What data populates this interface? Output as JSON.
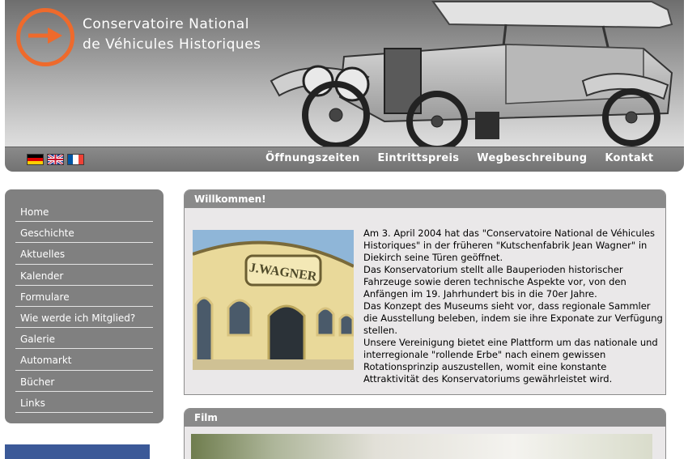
{
  "site": {
    "title_line1": "Conservatoire National",
    "title_line2": "de Véhicules Historiques",
    "accent_color": "#ee6a2c"
  },
  "languages": [
    {
      "name": "Deutsch",
      "icon": "german-flag-icon"
    },
    {
      "name": "English",
      "icon": "uk-flag-icon"
    },
    {
      "name": "Français",
      "icon": "french-flag-icon"
    }
  ],
  "nav": {
    "links": [
      "Öffnungszeiten",
      "Eintrittspreis",
      "Wegbeschreibung",
      "Kontakt"
    ]
  },
  "sidebar": {
    "items": [
      "Home",
      "Geschichte",
      "Aktuelles",
      "Kalender",
      "Formulare",
      "Wie werde ich Mitglied?",
      "Galerie",
      "Automarkt",
      "Bücher",
      "Links"
    ]
  },
  "welcome": {
    "heading": "Willkommen!",
    "building_sign": "J.WAGNER",
    "paragraphs": [
      "Am 3. April 2004 hat das \"Conservatoire National de Véhicules Historiques\" in der früheren \"Kutschenfabrik Jean Wagner\" in Diekirch seine Türen geöffnet.",
      "Das Konservatorium stellt alle Bauperioden historischer Fahrzeuge sowie deren technische Aspekte vor, von den Anfängen im 19. Jahrhundert bis in die 70er Jahre.",
      "Das Konzept des Museums sieht vor, dass regionale Sammler die Ausstellung beleben, indem sie ihre Exponate zur Verfügung stellen.",
      "Unsere Vereinigung bietet eine Plattform um das nationale und interregionale \"rollende Erbe\" nach einem gewissen Rotationsprinzip auszustellen, womit eine konstante Attraktivität des Konservatoriums gewährleistet wird."
    ]
  },
  "film": {
    "heading": "Film"
  }
}
